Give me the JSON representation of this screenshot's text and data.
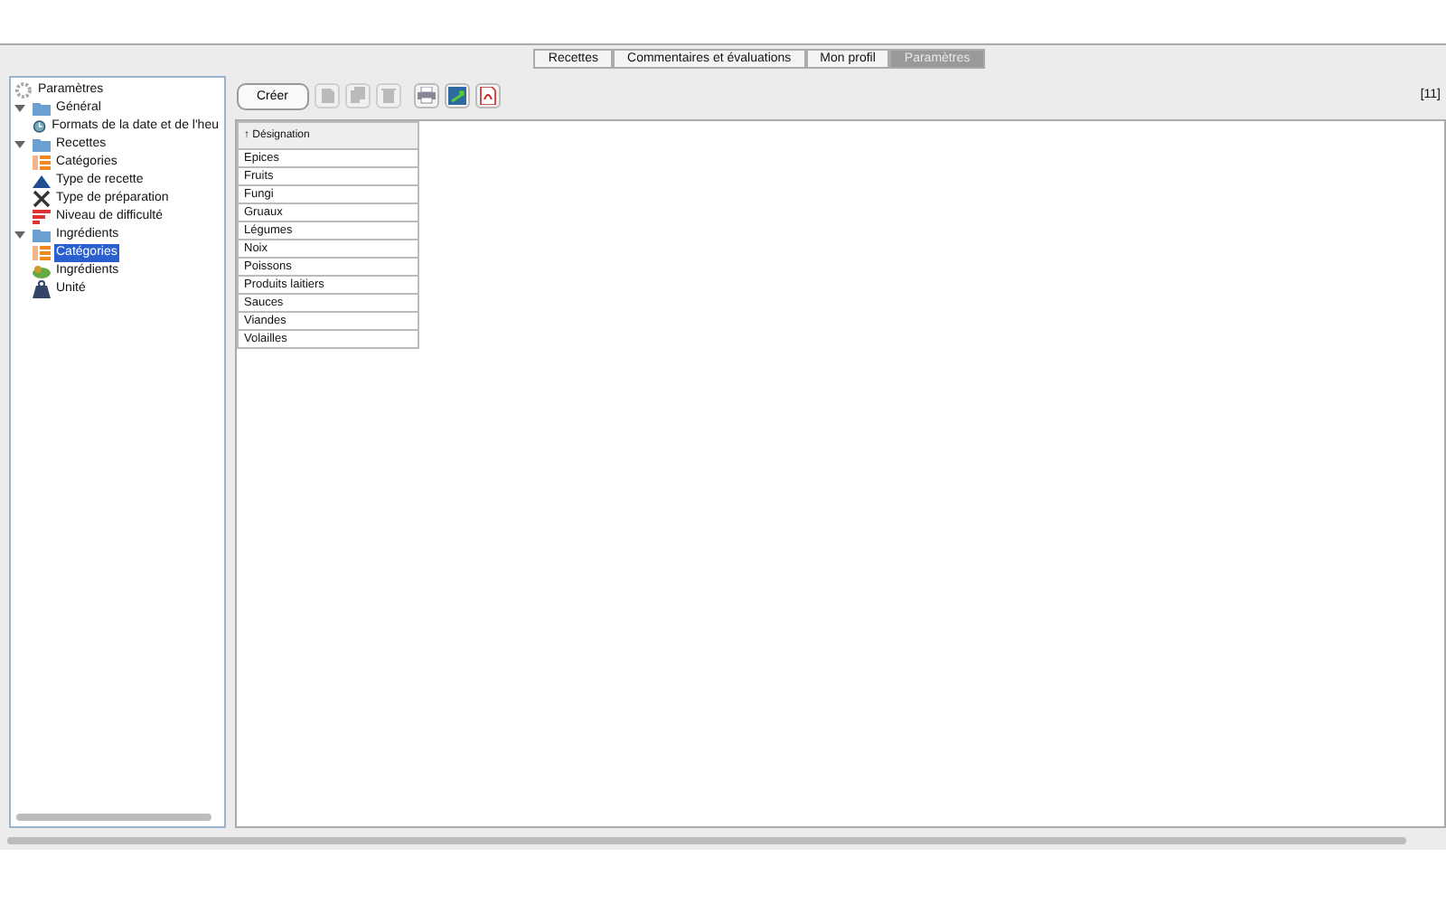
{
  "tabs": [
    {
      "label": "Recettes",
      "selected": false
    },
    {
      "label": "Commentaires et évaluations",
      "selected": false
    },
    {
      "label": "Mon profil",
      "selected": false
    },
    {
      "label": "Paramètres",
      "selected": true
    }
  ],
  "tree": {
    "label": "Paramètres",
    "kind": "gear",
    "children": [
      {
        "label": "Général",
        "kind": "folder",
        "expanded": true,
        "selected": false,
        "children": [
          {
            "label": "Formats de la date et de l'heu",
            "kind": "clock",
            "selected": false
          }
        ]
      },
      {
        "label": "Recettes",
        "kind": "folder",
        "expanded": true,
        "selected": false,
        "children": [
          {
            "label": "Catégories",
            "kind": "category",
            "selected": false
          },
          {
            "label": "Type de recette",
            "kind": "triangle",
            "selected": false
          },
          {
            "label": "Type de préparation",
            "kind": "tools",
            "selected": false
          },
          {
            "label": "Niveau de difficulté",
            "kind": "bars",
            "selected": false
          }
        ]
      },
      {
        "label": "Ingrédients",
        "kind": "folder",
        "expanded": true,
        "selected": false,
        "children": [
          {
            "label": "Catégories",
            "kind": "category",
            "selected": true
          },
          {
            "label": "Ingrédients",
            "kind": "ingredient",
            "selected": false
          },
          {
            "label": "Unité",
            "kind": "weight",
            "selected": false
          }
        ]
      }
    ]
  },
  "toolbar": {
    "create_label": "Créer",
    "tools": [
      {
        "kind": "cut",
        "disabled": true
      },
      {
        "kind": "copy",
        "disabled": true
      },
      {
        "kind": "delete",
        "disabled": true
      },
      {
        "kind": "print",
        "disabled": false
      },
      {
        "kind": "export",
        "disabled": false
      },
      {
        "kind": "pdf",
        "disabled": false
      }
    ],
    "count": "[11]"
  },
  "table": {
    "columns": [
      "↑ Désignation"
    ],
    "rows": [
      "Epices",
      "Fruits",
      "Fungi",
      "Gruaux",
      "Légumes",
      "Noix",
      "Poissons",
      "Produits laitiers",
      "Sauces",
      "Viandes",
      "Volailles"
    ]
  }
}
